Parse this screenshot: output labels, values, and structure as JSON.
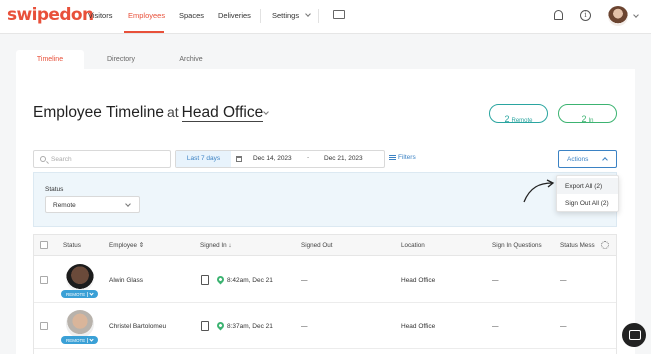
{
  "brand": {
    "logo_text": "swipedon",
    "accent": "#e8503a"
  },
  "nav": {
    "visitors": "Visitors",
    "employees": "Employees",
    "spaces": "Spaces",
    "deliveries": "Deliveries",
    "settings": "Settings"
  },
  "tabs": {
    "timeline": "Timeline",
    "directory": "Directory",
    "archive": "Archive"
  },
  "header": {
    "title": "Employee Timeline",
    "at": "at",
    "location": "Head Office"
  },
  "stats": {
    "remote": {
      "count": "2",
      "label": "Remote"
    },
    "in": {
      "count": "2",
      "label": "In"
    }
  },
  "toolbar": {
    "search_placeholder": "Search",
    "date_preset": "Last 7 days",
    "date_from": "Dec 14, 2023",
    "date_sep": "-",
    "date_to": "Dec 21, 2023",
    "filters": "Filters",
    "actions": "Actions"
  },
  "actions_menu": {
    "export_all": "Export All (2)",
    "sign_out_all": "Sign Out All (2)"
  },
  "filter_panel": {
    "status_label": "Status",
    "status_value": "Remote"
  },
  "table": {
    "headers": {
      "status": "Status",
      "employee": "Employee",
      "signed_in": "Signed In",
      "signed_out": "Signed Out",
      "location": "Location",
      "sign_in_questions": "Sign In Questions",
      "status_message": "Status Mess"
    },
    "rows": [
      {
        "badge": "REMOTE",
        "name": "Alwin Glass",
        "signed_in": "8:42am, Dec 21",
        "signed_out": "—",
        "location": "Head Office",
        "questions": "—",
        "status_message": "—"
      },
      {
        "badge": "REMOTE",
        "name": "Christel Bartolomeu",
        "signed_in": "8:37am, Dec 21",
        "signed_out": "—",
        "location": "Head Office",
        "questions": "—",
        "status_message": "—"
      }
    ]
  }
}
